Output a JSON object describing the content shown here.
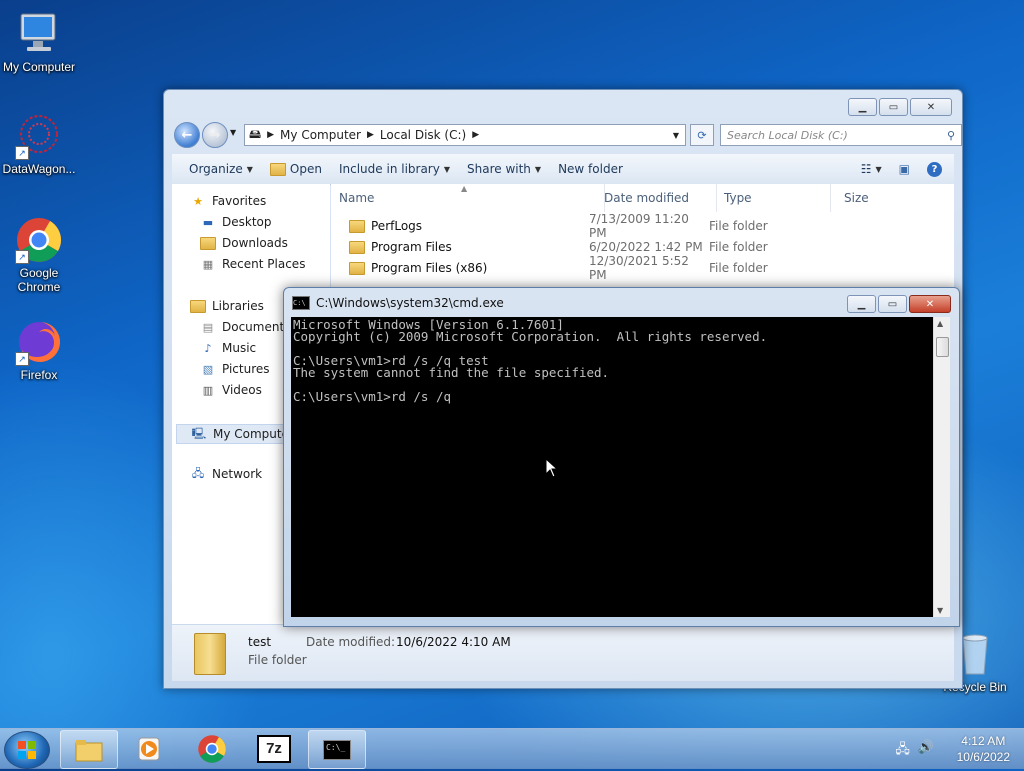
{
  "desktop": {
    "icons": [
      {
        "label": "My Computer",
        "icon": "computer-icon"
      },
      {
        "label": "DataWagon...",
        "icon": "datawagon-icon"
      },
      {
        "label": "Google Chrome",
        "icon": "chrome-icon"
      },
      {
        "label": "Firefox",
        "icon": "firefox-icon"
      },
      {
        "label": "Recycle Bin",
        "icon": "recycle-bin-icon"
      }
    ]
  },
  "explorer": {
    "breadcrumb": [
      "My Computer",
      "Local Disk (C:)"
    ],
    "search_placeholder": "Search Local Disk (C:)",
    "toolbar": {
      "organize": "Organize",
      "open": "Open",
      "include_in_library": "Include in library",
      "share_with": "Share with",
      "new_folder": "New folder"
    },
    "nav": {
      "favorites": "Favorites",
      "desktop": "Desktop",
      "downloads": "Downloads",
      "recent_places": "Recent Places",
      "libraries": "Libraries",
      "documents": "Documents",
      "music": "Music",
      "pictures": "Pictures",
      "videos": "Videos",
      "my_computer": "My Computer",
      "network": "Network"
    },
    "columns": {
      "name": "Name",
      "date_modified": "Date modified",
      "type": "Type",
      "size": "Size"
    },
    "rows": [
      {
        "name": "PerfLogs",
        "date": "7/13/2009 11:20 PM",
        "type": "File folder"
      },
      {
        "name": "Program Files",
        "date": "6/20/2022 1:42 PM",
        "type": "File folder"
      },
      {
        "name": "Program Files (x86)",
        "date": "12/30/2021 5:52 PM",
        "type": "File folder"
      }
    ],
    "details": {
      "name": "test",
      "date_label": "Date modified:",
      "date_value": "10/6/2022 4:10 AM",
      "type": "File folder"
    }
  },
  "cmd": {
    "title": "C:\\Windows\\system32\\cmd.exe",
    "lines": [
      "Microsoft Windows [Version 6.1.7601]",
      "Copyright (c) 2009 Microsoft Corporation.  All rights reserved.",
      "",
      "C:\\Users\\vm1>rd /s /q test",
      "The system cannot find the file specified.",
      "",
      "C:\\Users\\vm1>rd /s /q"
    ]
  },
  "taskbar": {
    "time": "4:12 AM",
    "date": "10/6/2022"
  }
}
